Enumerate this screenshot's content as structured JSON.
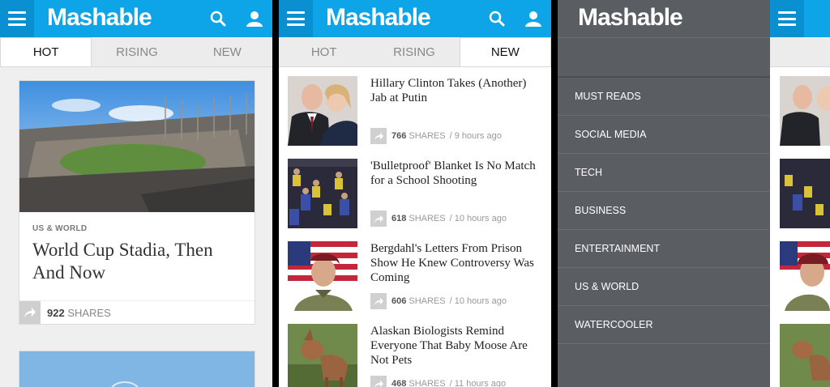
{
  "brand": "Mashable",
  "colors": {
    "header": "#0ea5e8",
    "menu_button": "#0a8fd0",
    "nav_bg": "#5a5e63"
  },
  "icons": {
    "menu": "hamburger-icon",
    "search": "search-icon",
    "user": "user-icon",
    "share": "share-arrow-icon"
  },
  "tabs": [
    "HOT",
    "RISING",
    "NEW"
  ],
  "panel1": {
    "active_tab": "HOT",
    "card": {
      "category": "US & WORLD",
      "title": "World Cup Stadia, Then And Now",
      "shares_count": "922",
      "shares_label": "SHARES"
    }
  },
  "panel2": {
    "active_tab": "NEW",
    "articles": [
      {
        "title": "Hillary Clinton Takes (Another) Jab at Putin",
        "shares": "766",
        "shares_label": "SHARES",
        "time": "/ 9 hours ago"
      },
      {
        "title": "'Bulletproof' Blanket Is No Match for a School Shooting",
        "shares": "618",
        "shares_label": "SHARES",
        "time": "/ 10 hours ago"
      },
      {
        "title": "Bergdahl's Letters From Prison Show He Knew Controversy Was Coming",
        "shares": "606",
        "shares_label": "SHARES",
        "time": "/ 10 hours ago"
      },
      {
        "title": "Alaskan Biologists Remind Everyone That Baby Moose Are Not Pets",
        "shares": "468",
        "shares_label": "SHARES",
        "time": "/ 11 hours ago"
      }
    ]
  },
  "panel3": {
    "nav": [
      "MUST READS",
      "SOCIAL MEDIA",
      "TECH",
      "BUSINESS",
      "ENTERTAINMENT",
      "US & WORLD",
      "WATERCOOLER"
    ]
  }
}
